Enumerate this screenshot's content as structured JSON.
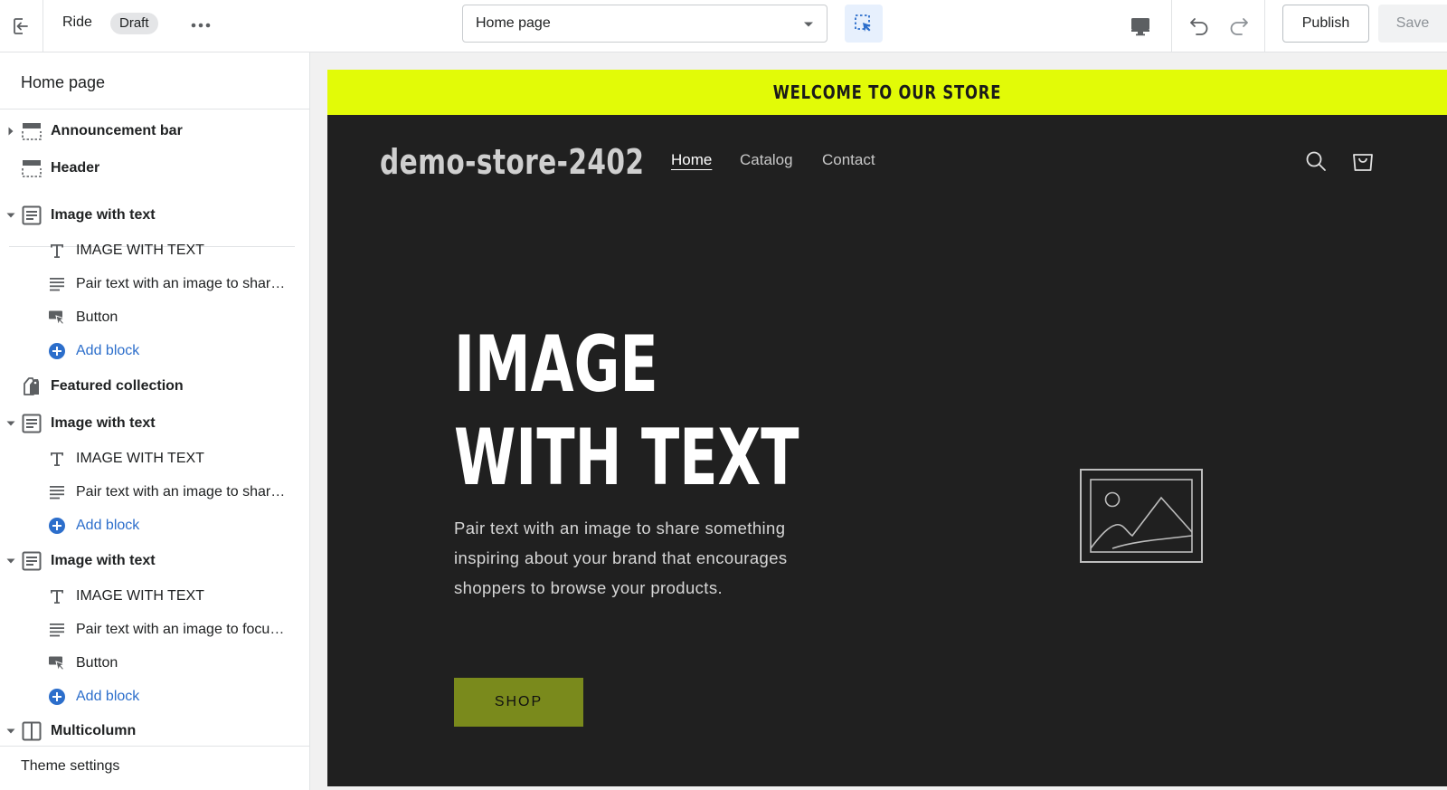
{
  "topbar": {
    "theme_name": "Ride",
    "status_badge": "Draft",
    "page_select": "Home page",
    "publish_label": "Publish",
    "save_label": "Save"
  },
  "sidebar": {
    "title": "Home page",
    "sections": [
      {
        "label": "Announcement bar",
        "icon": "announcement-bar-icon"
      },
      {
        "label": "Header",
        "icon": "header-icon"
      },
      {
        "label": "Image with text",
        "icon": "image-with-text-icon",
        "blocks": [
          "IMAGE WITH TEXT",
          "Pair text with an image to shar…",
          "Button"
        ],
        "add": "Add block"
      },
      {
        "label": "Featured collection",
        "icon": "featured-collection-icon"
      },
      {
        "label": "Image with text",
        "icon": "image-with-text-icon",
        "blocks": [
          "IMAGE WITH TEXT",
          "Pair text with an image to shar…"
        ],
        "add": "Add block"
      },
      {
        "label": "Image with text",
        "icon": "image-with-text-icon",
        "blocks": [
          "IMAGE WITH TEXT",
          "Pair text with an image to focu…",
          "Button"
        ],
        "add": "Add block"
      },
      {
        "label": "Multicolumn",
        "icon": "multicolumn-icon"
      }
    ],
    "footer_label": "Theme settings"
  },
  "preview": {
    "announcement": "WELCOME TO OUR STORE",
    "store_name": "demo-store-2402",
    "nav": [
      "Home",
      "Catalog",
      "Contact"
    ],
    "hero_title_line1": "IMAGE",
    "hero_title_line2": "WITH TEXT",
    "hero_text": "Pair text with an image to share something inspiring about your brand that encourages shoppers to browse your products.",
    "hero_button": "SHOP"
  },
  "colors": {
    "announcement_bg": "#e2fb07",
    "preview_bg": "#202020",
    "button_bg": "#7a8a1c",
    "link_blue": "#2c6ecb"
  }
}
